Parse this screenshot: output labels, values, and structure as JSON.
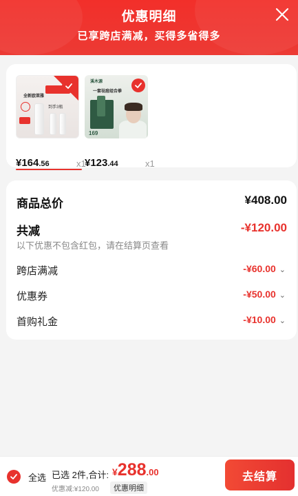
{
  "header": {
    "title": "优惠明细",
    "subtitle": "已享跨店满减，买得多省得多",
    "close_icon": "close-icon"
  },
  "products": [
    {
      "price_int": "¥164",
      "price_dec": ".56",
      "qty": "x1",
      "selected": true,
      "thumb_text_1": "全新欧莱雅",
      "thumb_text_2": "到手3瓶"
    },
    {
      "price_int": "¥123",
      "price_dec": ".44",
      "qty": "x1",
      "selected": true,
      "thumb_text_1": "一套祛痘组合拳",
      "thumb_text_2": "169"
    }
  ],
  "summary": {
    "total_label": "商品总价",
    "total_value": "¥408.00",
    "reduce_label": "共减",
    "reduce_value": "-¥120.00",
    "note": "以下优惠不包含红包，请在结算页查看",
    "items": [
      {
        "label": "跨店满减",
        "value": "-¥60.00"
      },
      {
        "label": "优惠券",
        "value": "-¥50.00"
      },
      {
        "label": "首购礼金",
        "value": "-¥10.00"
      }
    ]
  },
  "footer": {
    "select_all": "全选",
    "selected_text": "已选 2件,合计:",
    "sum_currency": "¥",
    "sum_int": "288",
    "sum_dec": ".00",
    "discount_text": "优惠减:¥120.00",
    "detail_label": "优惠明细",
    "checkout_label": "去结算"
  },
  "colors": {
    "accent": "#e8322d",
    "header": "#f22f2a"
  }
}
